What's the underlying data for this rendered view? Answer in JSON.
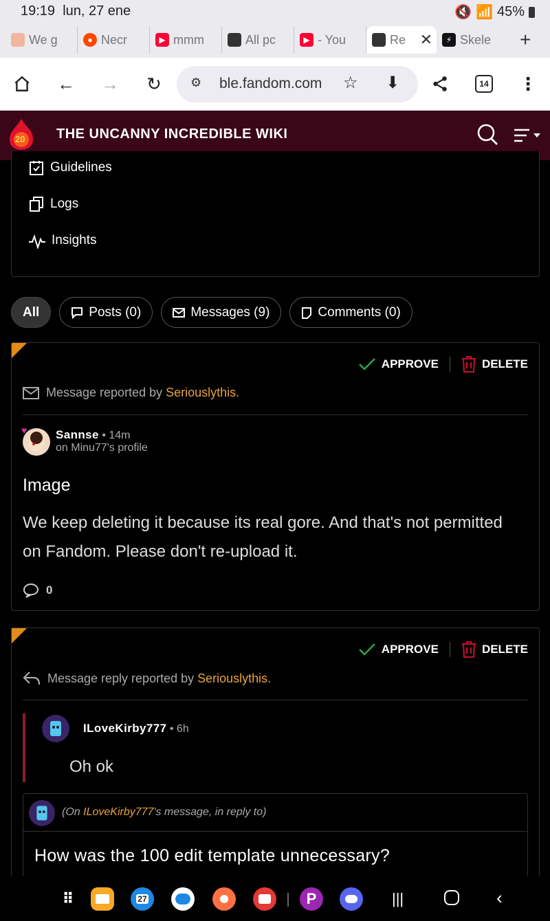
{
  "status_bar": {
    "time": "19:19",
    "date": "lun, 27 ene",
    "battery": "45%"
  },
  "browser_tabs": [
    {
      "label": "We g",
      "icon": "tab-favicon-1",
      "color": "#f2b5a0"
    },
    {
      "label": "Necr",
      "icon": "reddit-icon",
      "color": "#ff4500"
    },
    {
      "label": "mmm",
      "icon": "youtube-icon",
      "color": "#ff0033"
    },
    {
      "label": "All pc",
      "icon": "tab-favicon-image",
      "color": "#333333"
    },
    {
      "label": "- You",
      "icon": "youtube-icon",
      "color": "#ff0033"
    },
    {
      "label": "Re",
      "icon": "tab-favicon-image",
      "color": "#333333",
      "active": true
    },
    {
      "label": "Skele",
      "icon": "tab-favicon-bolt",
      "color": "#111111"
    }
  ],
  "url_bar": {
    "url": "ble.fandom.com",
    "tab_count": "14"
  },
  "wiki": {
    "title": "THE UNCANNY INCREDIBLE WIKI",
    "logo_text": "20",
    "brand_color": "#3a0618"
  },
  "side_menu": [
    {
      "label": "Guidelines",
      "icon": "checklist-icon"
    },
    {
      "label": "Logs",
      "icon": "copy-icon"
    },
    {
      "label": "Insights",
      "icon": "pulse-icon"
    }
  ],
  "filters": [
    {
      "label": "All",
      "active": true
    },
    {
      "label": "Posts (0)",
      "icon": "post-icon"
    },
    {
      "label": "Messages (9)",
      "icon": "envelope-icon"
    },
    {
      "label": "Comments (0)",
      "icon": "comment-icon"
    }
  ],
  "actions": {
    "approve": "APPROVE",
    "delete": "DELETE"
  },
  "report1": {
    "type_text": "Message reported by",
    "reporter": "Seriouslythis.",
    "author": "Sannse",
    "time": "14m",
    "context": "on Minu77's profile",
    "title": "Image",
    "body": "We keep deleting it because its real gore. And that's not permitted on Fandom. Please don't re-upload it.",
    "reply_count": "0"
  },
  "report2": {
    "type_text": "Message reply reported by",
    "reporter": "Seriouslythis.",
    "author": "ILoveKirby777",
    "time": "6h",
    "body": "Oh ok",
    "parent_prefix": "(On",
    "parent_author": "ILoveKirby777",
    "parent_suffix": "'s message, in reply to)",
    "parent_title": "How was the 100 edit template unnecessary?"
  },
  "colors": {
    "accent_orange": "#e38a1b",
    "approve_green": "#2ea44f",
    "delete_red": "#c8102e",
    "link_orange": "#e8a33c"
  },
  "dock_apps": [
    {
      "icon": "apps-grid-icon"
    },
    {
      "icon": "files-icon"
    },
    {
      "icon": "calendar-icon",
      "text": "27"
    },
    {
      "icon": "messages-icon"
    },
    {
      "icon": "contacts-icon"
    },
    {
      "icon": "camera-icon"
    },
    {
      "icon": "picsart-icon"
    },
    {
      "icon": "discord-icon"
    }
  ]
}
